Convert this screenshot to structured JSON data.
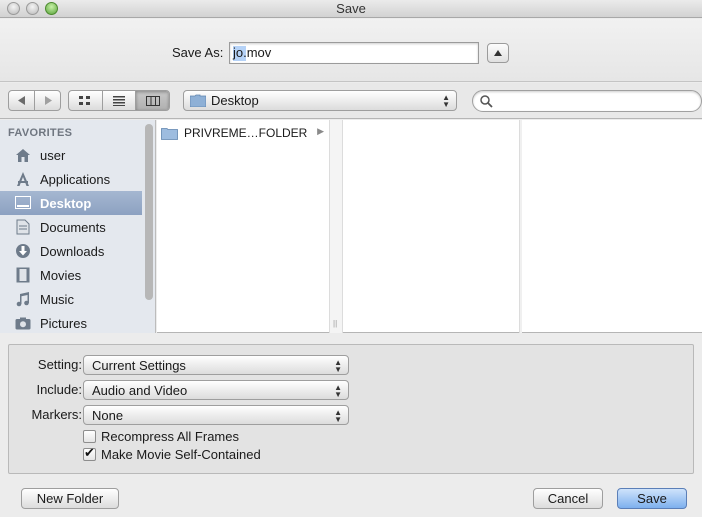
{
  "window": {
    "title": "Save"
  },
  "save_as": {
    "label": "Save As:",
    "filename": "jo.mov"
  },
  "toolbar": {
    "back_icon": "chevron-left-icon",
    "forward_icon": "chevron-right-icon",
    "view_modes": [
      "icon-view",
      "list-view",
      "column-view"
    ],
    "active_view": "column-view",
    "location": "Desktop",
    "search_placeholder": ""
  },
  "sidebar": {
    "header": "FAVORITES",
    "items": [
      {
        "label": "user",
        "icon": "home-icon"
      },
      {
        "label": "Applications",
        "icon": "applications-icon"
      },
      {
        "label": "Desktop",
        "icon": "desktop-icon",
        "selected": true
      },
      {
        "label": "Documents",
        "icon": "documents-icon"
      },
      {
        "label": "Downloads",
        "icon": "downloads-icon"
      },
      {
        "label": "Movies",
        "icon": "movies-icon"
      },
      {
        "label": "Music",
        "icon": "music-icon"
      },
      {
        "label": "Pictures",
        "icon": "pictures-icon"
      }
    ]
  },
  "browser": {
    "column1": [
      {
        "name": "PRIVREME…FOLDER",
        "icon": "folder-icon",
        "has_children": true
      }
    ]
  },
  "options": {
    "setting": {
      "label": "Setting:",
      "value": "Current Settings"
    },
    "include": {
      "label": "Include:",
      "value": "Audio and Video"
    },
    "markers": {
      "label": "Markers:",
      "value": "None"
    },
    "recompress": {
      "label": "Recompress All Frames",
      "checked": false
    },
    "self_contained": {
      "label": "Make Movie Self-Contained",
      "checked": true
    }
  },
  "buttons": {
    "new_folder": "New Folder",
    "cancel": "Cancel",
    "save": "Save"
  },
  "colors": {
    "selection": "#8ca1c1",
    "default_button": "#7eb0ee"
  }
}
